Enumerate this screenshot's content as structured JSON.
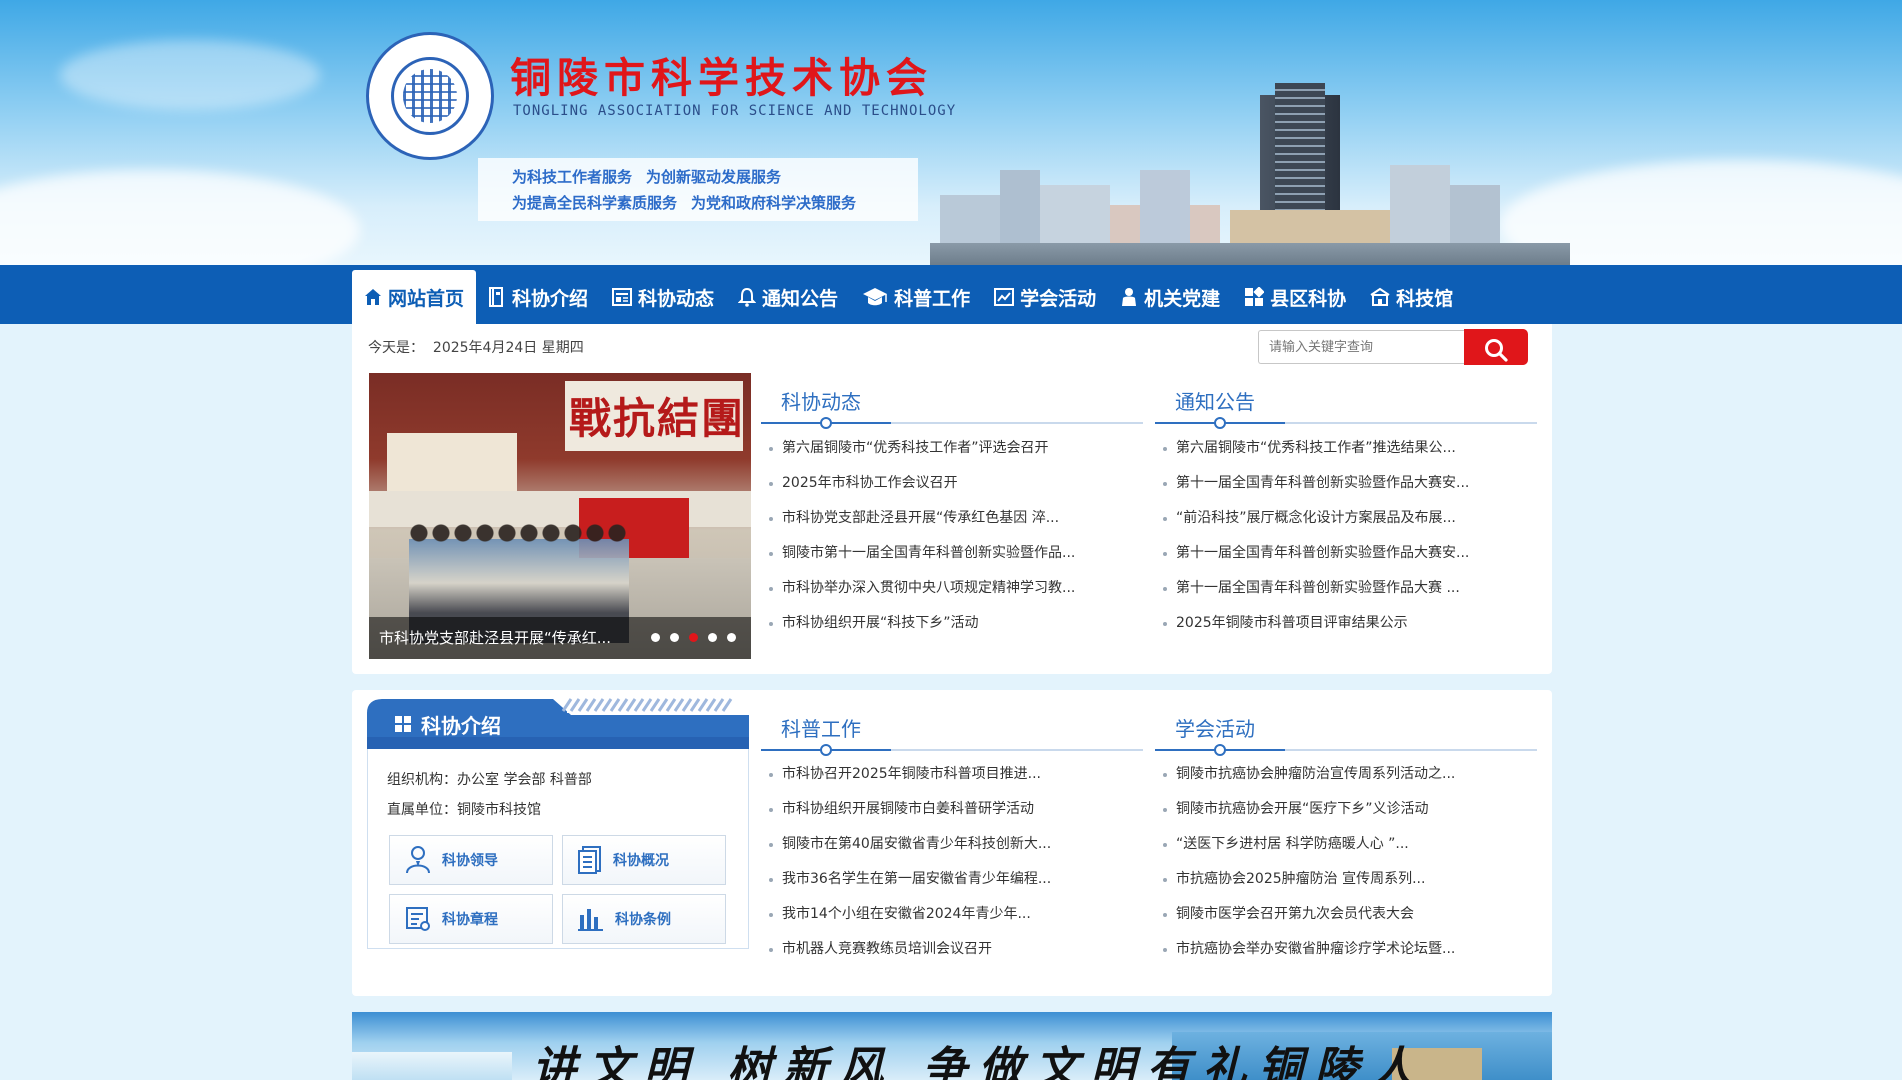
{
  "header": {
    "title": "铜陵市科学技术协会",
    "subtitle": "TONGLING ASSOCIATION FOR SCIENCE AND TECHNOLOGY",
    "slogans": [
      [
        "为科技工作者服务",
        "为创新驱动发展服务"
      ],
      [
        "为提高全民科学素质服务",
        "为党和政府科学决策服务"
      ]
    ],
    "logo_icon": "cast-seal-logo"
  },
  "nav": {
    "items": [
      {
        "label": "网站首页",
        "icon": "home-icon",
        "active": true
      },
      {
        "label": "科协介绍",
        "icon": "book-icon"
      },
      {
        "label": "科协动态",
        "icon": "newspaper-icon"
      },
      {
        "label": "通知公告",
        "icon": "bell-icon"
      },
      {
        "label": "科普工作",
        "icon": "graduation-cap-icon"
      },
      {
        "label": "学会活动",
        "icon": "chart-icon"
      },
      {
        "label": "机关党建",
        "icon": "person-icon"
      },
      {
        "label": "县区科协",
        "icon": "grid-icon"
      },
      {
        "label": "科技馆",
        "icon": "building-icon"
      }
    ]
  },
  "today": {
    "label": "今天是：",
    "value": "2025年4月24日 星期四"
  },
  "search": {
    "placeholder": "请输入关键字查询"
  },
  "slider": {
    "caption": "市科协党支部赴泾县开展“传承红...",
    "banner_text": "戰抗結團",
    "active_dot": 2,
    "dot_count": 5
  },
  "news": {
    "title": "科协动态",
    "items": [
      "第六届铜陵市“优秀科技工作者”评选会召开",
      "2025年市科协工作会议召开",
      "市科协党支部赴泾县开展“传承红色基因 淬...",
      "铜陵市第十一届全国青年科普创新实验暨作品...",
      "市科协举办深入贯彻中央八项规定精神学习教...",
      "市科协组织开展“科技下乡”活动"
    ]
  },
  "notices": {
    "title": "通知公告",
    "items": [
      "第六届铜陵市“优秀科技工作者”推选结果公...",
      "第十一届全国青年科普创新实验暨作品大赛安...",
      "“前沿科技”展厅概念化设计方案展品及布展...",
      "第十一届全国青年科普创新实验暨作品大赛安...",
      "第十一届全国青年科普创新实验暨作品大赛 ...",
      "2025年铜陵市科普项目评审结果公示"
    ]
  },
  "intro": {
    "title": "科协介绍",
    "org_label": "组织机构：",
    "org_value": "办公室 学会部 科普部",
    "unit_label": "直属单位：",
    "unit_value": "铜陵市科技馆",
    "buttons": [
      {
        "label": "科协领导",
        "icon": "leader-icon"
      },
      {
        "label": "科协概况",
        "icon": "document-icon"
      },
      {
        "label": "科协章程",
        "icon": "charter-icon"
      },
      {
        "label": "科协条例",
        "icon": "regulation-icon"
      }
    ]
  },
  "popsci": {
    "title": "科普工作",
    "items": [
      "市科协召开2025年铜陵市科普项目推进...",
      "市科协组织开展铜陵市白姜科普研学活动",
      "铜陵市在第40届安徽省青少年科技创新大...",
      "我市36名学生在第一届安徽省青少年编程...",
      "我市14个小组在安徽省2024年青少年...",
      "市机器人竞赛教练员培训会议召开"
    ]
  },
  "society": {
    "title": "学会活动",
    "items": [
      "铜陵市抗癌协会肿瘤防治宣传周系列活动之...",
      "铜陵市抗癌协会开展“医疗下乡”义诊活动",
      "“送医下乡进村居 科学防癌暖人心 ”...",
      "市抗癌协会2025肿瘤防治 宣传周系列...",
      "铜陵市医学会召开第九次会员代表大会",
      "市抗癌协会举办安徽省肿瘤诊疗学术论坛暨..."
    ]
  },
  "banner": {
    "text": "讲文明 树新风 争做文明有礼铜陵人"
  },
  "colors": {
    "brand_blue": "#0d5eb5",
    "accent_red": "#e0161a",
    "title_blue": "#2e6fc0"
  }
}
